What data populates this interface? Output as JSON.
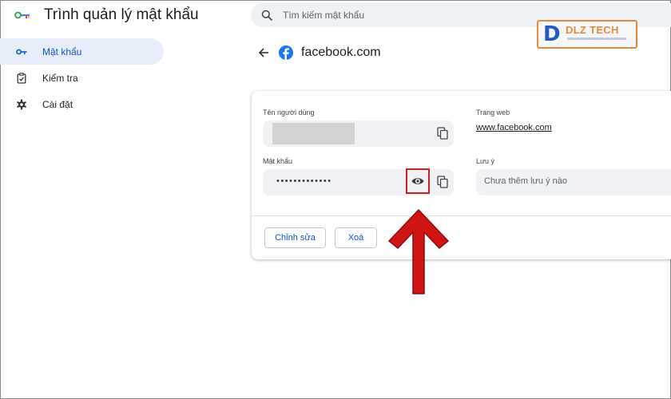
{
  "header": {
    "app_title": "Trình quản lý mật khẩu",
    "search_placeholder": "Tìm kiếm mật khẩu",
    "logo_icon": "key-icon"
  },
  "sidebar": {
    "items": [
      {
        "label": "Mật khẩu",
        "icon": "key-icon",
        "active": true
      },
      {
        "label": "Kiểm tra",
        "icon": "clipboard-check-icon",
        "active": false
      },
      {
        "label": "Cài đặt",
        "icon": "gear-icon",
        "active": false
      }
    ]
  },
  "detail": {
    "back_icon": "arrow-left-icon",
    "site_icon": "facebook-icon",
    "site_title": "facebook.com",
    "username_label": "Tên người dùng",
    "password_label": "Mật khẩu",
    "password_value": "•••••••••••••",
    "website_label": "Trang web",
    "website_value": "www.facebook.com",
    "note_label": "Lưu ý",
    "note_placeholder": "Chưa thêm lưu ý nào",
    "edit_button": "Chỉnh sửa",
    "delete_button": "Xoá"
  },
  "watermark": {
    "text": "DLZ TECH"
  },
  "colors": {
    "accent": "#0b57d0",
    "active_nav_bg": "#e8eef9",
    "highlight": "#d21f1f",
    "facebook_blue": "#1877f2"
  }
}
